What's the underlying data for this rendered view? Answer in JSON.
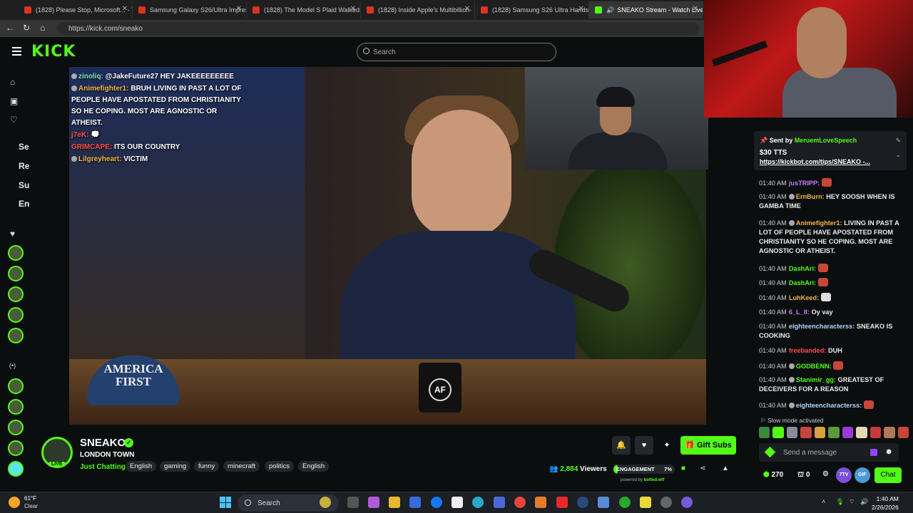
{
  "browser": {
    "tabs": [
      {
        "label": "(1828) Please Stop, Microsoft... - Y",
        "active": false
      },
      {
        "label": "Samsung Galaxy S26/Ultra Impres",
        "active": false
      },
      {
        "label": "(1828) The Model S Plaid Walked",
        "active": false
      },
      {
        "label": "(1828) Inside Apple's Multibillion-",
        "active": false
      },
      {
        "label": "(1828) Samsung S26 Ultra Hands",
        "active": false
      },
      {
        "label": "SNEAKO Stream - Watch Live",
        "active": true
      }
    ],
    "url": "https://kick.com/sneako"
  },
  "header": {
    "logo": "KICK",
    "search_placeholder": "Search"
  },
  "sidebar": {
    "labels": [
      "Se",
      "Re",
      "Su",
      "En"
    ],
    "collapse_glyph": "(•)"
  },
  "overlay_chat": [
    {
      "user": "zinoliq:",
      "user_color": "#7ee8c8",
      "text": "@JakeFuture27 HEY JAKEEEEEEEEE"
    },
    {
      "user": "Animefighter1:",
      "user_color": "#f3b544",
      "text": "BRUH LIVING IN PAST A LOT OF PEOPLE HAVE APOSTATED FROM CHRISTIANITY SO HE COPING. MOST ARE AGNOSTIC OR ATHEIST."
    },
    {
      "user": "j7eK:",
      "user_color": "#ff4a4a",
      "text": ""
    },
    {
      "user": "GRIMCAPE:",
      "user_color": "#ff4a4a",
      "text": "ITS OUR COUNTRY"
    },
    {
      "user": "Lilgreyheart:",
      "user_color": "#f3b544",
      "text": "VICTIM"
    }
  ],
  "video": {
    "hat_text": "AMERICA FIRST",
    "mug_text": "AF"
  },
  "chat": {
    "pinned": {
      "sent_by_label": "Sent by",
      "sender": "MeruemLoveSpeech",
      "amount": "$30 TTS",
      "link": "https://kickbot.com/tips/SNEAKO -..."
    },
    "messages": [
      {
        "time": "01:40 AM",
        "user": "jusTRIPP:",
        "color": "#c77dff",
        "text": ""
      },
      {
        "time": "01:40 AM",
        "user": "ErnBurn:",
        "color": "#f3b544",
        "text": "HEY SOOSH WHEN IS GAMBA TIME"
      },
      {
        "time": "01:40 AM",
        "user": "Animefighter1:",
        "color": "#f3b544",
        "text": "LIVING IN PAST A LOT OF PEOPLE HAVE APOSTATED FROM CHRISTIANITY SO HE COPING. MOST ARE AGNOSTIC OR ATHEIST."
      },
      {
        "time": "01:40 AM",
        "user": "DashAri:",
        "color": "#53fc18",
        "text": ""
      },
      {
        "time": "01:40 AM",
        "user": "DashAri:",
        "color": "#53fc18",
        "text": ""
      },
      {
        "time": "01:40 AM",
        "user": "LuhKeed:",
        "color": "#f3b544",
        "text": ""
      },
      {
        "time": "01:40 AM",
        "user": "6_L_8:",
        "color": "#c77dff",
        "text": "Oy vay"
      },
      {
        "time": "01:40 AM",
        "user": "eighteencharacterss:",
        "color": "#b1d4ff",
        "text": "SNEAKO IS COOKING"
      },
      {
        "time": "01:40 AM",
        "user": "freebanded:",
        "color": "#ff4a4a",
        "text": "DUH"
      },
      {
        "time": "01:40 AM",
        "user": "GODBENN:",
        "color": "#53fc18",
        "text": ""
      },
      {
        "time": "01:40 AM",
        "user": "Stanimir_gg:",
        "color": "#53fc18",
        "text": "GREATEST OF DECEIVERS FOR A REASON"
      },
      {
        "time": "01:40 AM",
        "user": "eighteencharacterss:",
        "color": "#b1d4ff",
        "text": ""
      }
    ],
    "slow_mode": "Slow mode activated",
    "input_placeholder": "Send a message",
    "points": "270",
    "count": "0",
    "badge_7tv": "7TV",
    "badge_gif": "GIF",
    "chat_button": "Chat"
  },
  "stream": {
    "channel_name": "SNEAKO",
    "live_label": "LIVE",
    "title": "LONDON TOWN",
    "category": "Just Chatting",
    "tags": [
      "English",
      "gaming",
      "funny",
      "minecraft",
      "politics",
      "English"
    ],
    "viewers_count": "2,884",
    "viewers_label": "Viewers",
    "engagement_label": "ENGAGEMENT",
    "engagement_pct": "7%",
    "engagement_value": 0.07,
    "powered_by_label": "powered by",
    "powered_by_brand": "botted.wtf",
    "gift_subs": "Gift Subs"
  },
  "taskbar": {
    "temp": "61°F",
    "condition": "Clear",
    "search": "Search",
    "time": "1:40 AM",
    "date": "2/26/2026"
  },
  "colors": {
    "kick_green": "#53fc18",
    "background": "#0b0e0f"
  }
}
